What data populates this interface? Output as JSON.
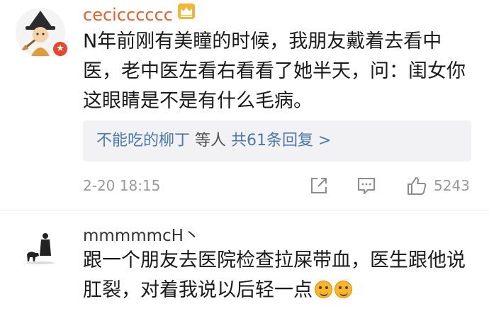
{
  "comments": [
    {
      "username": "cecicccccc",
      "text": "N年前刚有美瞳的时候，我朋友戴着去看中医，老中医左看右看看了她半天，问：闺女你这眼睛是不是有什么毛病。",
      "reply_preview": {
        "users": "不能吃的柳丁",
        "connector": "等人",
        "count_label": "共61条回复 >"
      },
      "timestamp": "2-20 18:15",
      "like_count": "5243",
      "avatar_icon": "witch-avatar-icon",
      "badge_icon": "vip-badge-icon"
    },
    {
      "username": "mmmmmcH丶",
      "text": "跟一个朋友去医院检查拉屎带血，医生跟他说肛裂，对着我说以后轻一点",
      "emojis": [
        "upside-down-face-icon",
        "upside-down-face-icon"
      ],
      "avatar_icon": "silhouette-avatar-icon"
    }
  ],
  "colors": {
    "vip_username": "#e8602c",
    "link_blue": "#4a79b1",
    "meta_gray": "#999999",
    "reply_bg": "#f2f2f4",
    "badge_red": "#e9452f"
  }
}
